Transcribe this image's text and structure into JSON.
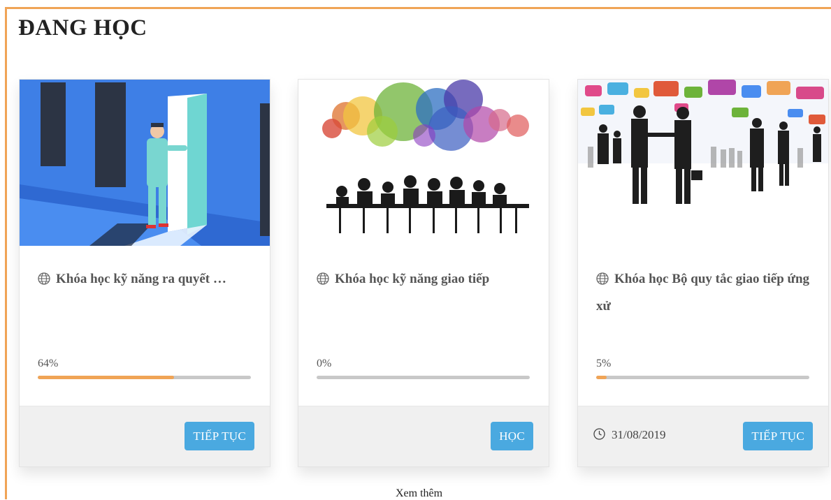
{
  "section": {
    "title": "ĐANG HỌC"
  },
  "courses": [
    {
      "title": "Khóa học kỹ năng ra quyết …",
      "progress_label": "64%",
      "progress": 0.64,
      "button_label": "TIẾP TỤC",
      "thumbnail_icon": "door-decision-illustration"
    },
    {
      "title": "Khóa học kỹ năng giao tiếp",
      "progress_label": "0%",
      "progress": 0.0,
      "button_label": "HỌC",
      "thumbnail_icon": "meeting-speech-bubbles-illustration"
    },
    {
      "title": "Khóa học Bộ quy tắc giao tiếp ứng xử",
      "progress_label": "5%",
      "progress": 0.05,
      "button_label": "TIẾP TỤC",
      "deadline": "31/08/2019",
      "thumbnail_icon": "business-handshake-illustration"
    }
  ],
  "see_more_label": "Xem thêm",
  "colors": {
    "accent": "#f0a456",
    "button": "#4aa9e0",
    "progress_track": "#c8c8c8",
    "footer_bg": "#f0f0f0"
  }
}
